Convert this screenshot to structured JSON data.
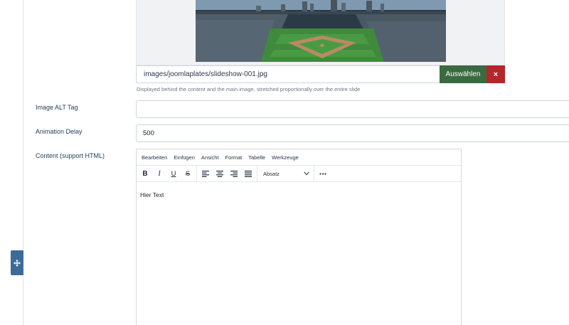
{
  "image_field": {
    "path_value": "images/joomlaplates/slideshow-001.jpg",
    "select_label": "Auswählen",
    "clear_label": "×",
    "help_text": "Displayed behind the content and the main image, stretched proportionally over the entire slide"
  },
  "alt_field": {
    "label": "Image ALT Tag",
    "value": ""
  },
  "delay_field": {
    "label": "Animation Delay",
    "value": "500"
  },
  "content_field": {
    "label": "Content (support HTML)",
    "menu": [
      "Bearbeiten",
      "Einfügen",
      "Ansicht",
      "Format",
      "Tabelle",
      "Werkzeuge"
    ],
    "format_select": "Absatz",
    "body_text": "Hier Text"
  },
  "colors": {
    "select_button": "#3a6a40",
    "clear_button": "#b3262a",
    "drag_handle": "#3d6a99",
    "label_text": "#1c3d5a"
  }
}
